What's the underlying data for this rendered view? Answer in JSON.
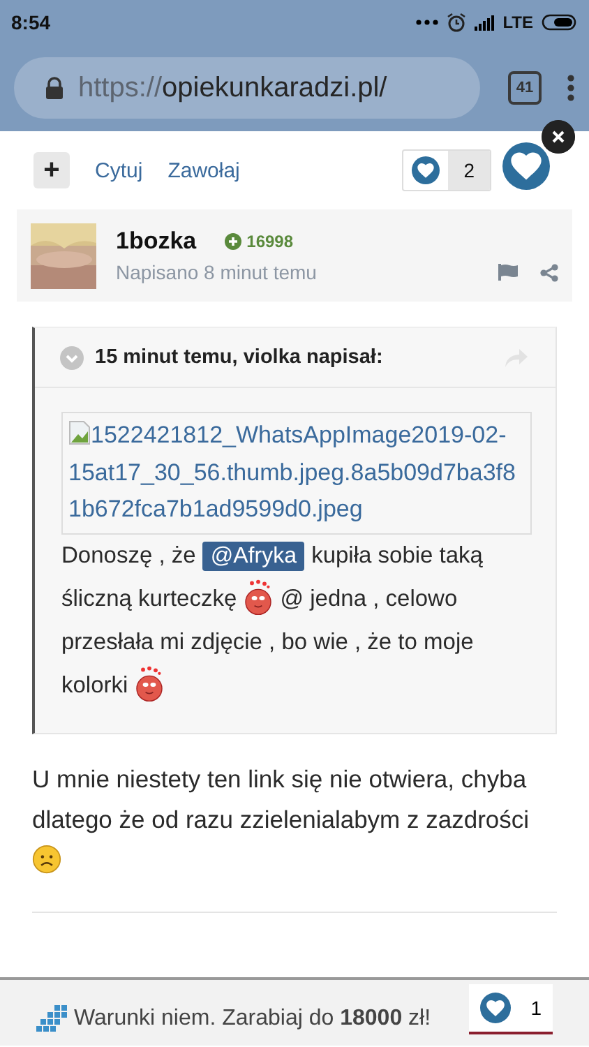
{
  "status_bar": {
    "time": "8:54",
    "network": "LTE"
  },
  "browser": {
    "url_scheme": "https://",
    "url_host": "opiekunkaradzi.pl/",
    "tab_count": "41"
  },
  "post_actions": {
    "expand": "+",
    "links": [
      "Cytuj",
      "Zawołaj"
    ],
    "reaction_count": "2"
  },
  "author": {
    "name": "1bozka",
    "reputation": "16998",
    "posted": "Napisano 8 minut temu"
  },
  "quote": {
    "header": "15 minut temu, violka napisał:",
    "image_alt": "1522421812_WhatsAppImage2019-02-15at17_30_56.thumb.jpeg.8a5b09d7ba3f81b672fca7b1ad9599d0.jpeg",
    "parts": [
      {
        "kind": "text",
        "text": "Donoszę , że "
      },
      {
        "kind": "mention",
        "text": "@Afryka"
      },
      {
        "kind": "text",
        "text": " kupiła sobie taką śliczną kurteczkę "
      },
      {
        "kind": "love-emoji"
      },
      {
        "kind": "text",
        "text": " @ jedna , celowo przesłała mi zdjęcie , bo wie , że to moje kolorki "
      },
      {
        "kind": "love-emoji"
      }
    ]
  },
  "reply": {
    "parts": [
      {
        "kind": "text",
        "text": "U mnie niestety ten link się nie otwiera, chyba dlatego że od razu zzielenialabym z zazdrości"
      },
      {
        "kind": "sad-emoji"
      }
    ]
  },
  "ad_bar": {
    "text": "Warunki niem. Zarabiaj do **18000** zł!",
    "reaction_count": "1"
  }
}
